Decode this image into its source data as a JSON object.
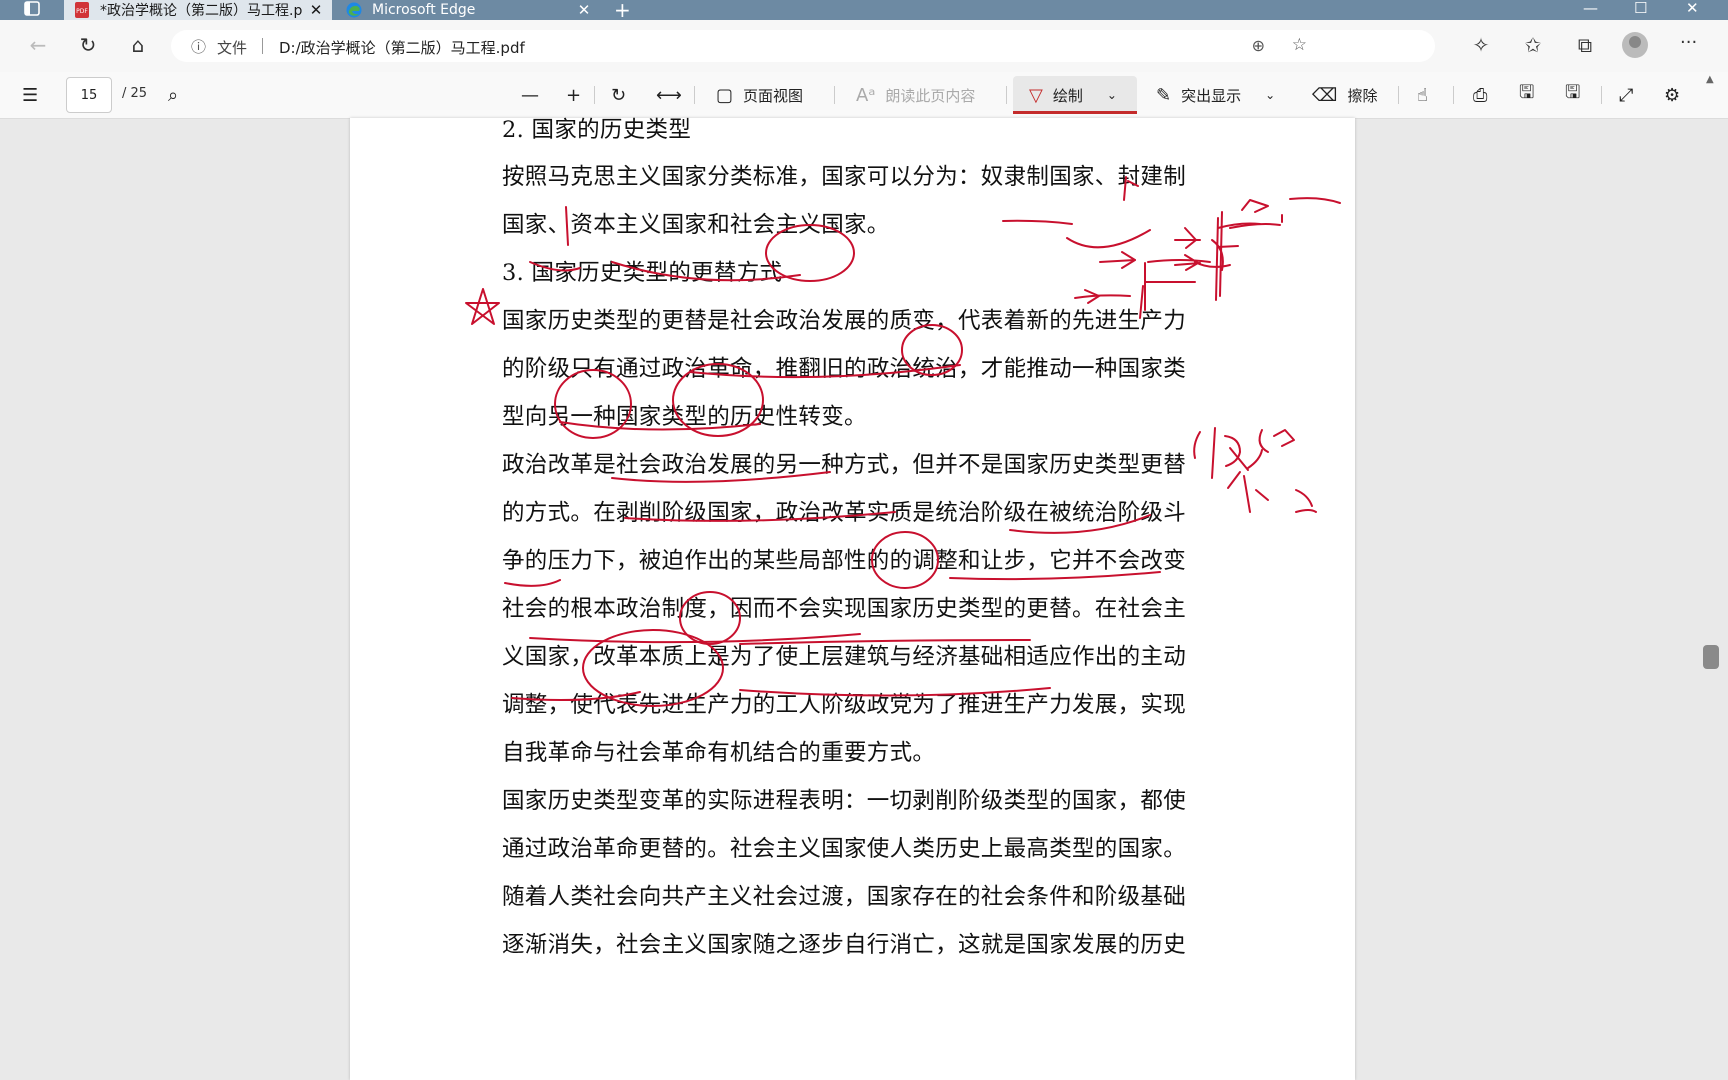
{
  "browser": {
    "tabs": [
      {
        "title": "*政治学概论（第二版）马工程.p",
        "active": true
      },
      {
        "title": "Microsoft Edge",
        "active": false
      }
    ],
    "address": {
      "label": "文件",
      "url": "D:/政治学概论（第二版）马工程.pdf"
    }
  },
  "pdf_toolbar": {
    "page_current": "15",
    "page_total": "/ 25",
    "page_view": "页面视图",
    "read_aloud": "朗读此页内容",
    "draw": "绘制",
    "highlight": "突出显示",
    "erase": "擦除"
  },
  "document": {
    "lines": [
      "2. 国家的历史类型",
      "按照马克思主义国家分类标准，国家可以分为：奴隶制国家、封建制",
      "国家、资本主义国家和社会主义国家。",
      "3. 国家历史类型的更替方式",
      "国家历史类型的更替是社会政治发展的质变，代表着新的先进生产力",
      "的阶级只有通过政治革命，推翻旧的政治统治，才能推动一种国家类",
      "型向另一种国家类型的历史性转变。",
      "政治改革是社会政治发展的另一种方式，但并不是国家历史类型更替",
      "的方式。在剥削阶级国家，政治改革实质是统治阶级在被统治阶级斗",
      "争的压力下，被迫作出的某些局部性的的调整和让步，它并不会改变",
      "社会的根本政治制度，因而不会实现国家历史类型的更替。在社会主",
      "义国家，改革本质上是为了使上层建筑与经济基础相适应作出的主动",
      "调整，使代表先进生产力的工人阶级政党为了推进生产力发展，实现",
      "自我革命与社会革命有机结合的重要方式。",
      "国家历史类型变革的实际进程表明：一切剥削阶级类型的国家，都使",
      "通过政治革命更替的。社会主义国家使人类历史上最高类型的国家。",
      "随着人类社会向共产主义社会过渡，国家存在的社会条件和阶级基础",
      "逐渐消失，社会主义国家随之逐步自行消亡，这就是国家发展的历史"
    ]
  },
  "colors": {
    "ink": "#c8102e",
    "tabbar": "#6d8aa3",
    "draw_accent": "#c42b2b"
  },
  "icons": [
    "window-icon",
    "pdf-icon",
    "edge-icon",
    "back-icon",
    "refresh-icon",
    "home-icon",
    "info-icon",
    "zoom-icon",
    "favorite-add-icon",
    "extensions-icon",
    "favorites-icon",
    "collections-icon",
    "more-icon",
    "toc-icon",
    "search-icon",
    "minus-icon",
    "plus-icon",
    "rotate-icon",
    "fit-width-icon",
    "page-view-icon",
    "read-aloud-icon",
    "draw-icon",
    "highlight-icon",
    "eraser-icon",
    "touch-icon",
    "print-icon",
    "save-icon",
    "save-as-icon",
    "fullscreen-icon",
    "settings-icon"
  ]
}
